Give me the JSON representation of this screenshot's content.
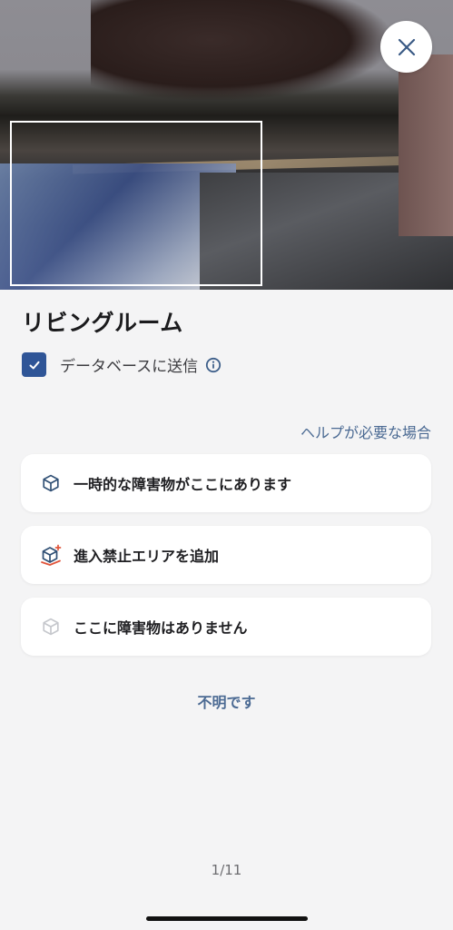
{
  "header": {
    "room_title": "リビングルーム",
    "close_icon": "close-icon"
  },
  "options": {
    "send_to_database_label": "データベースに送信",
    "send_to_database_checked": true,
    "info_icon": "info-icon"
  },
  "help_link": "ヘルプが必要な場合",
  "choices": [
    {
      "label": "一時的な障害物がここにあります",
      "icon": "box-icon",
      "color": "#2f4f74"
    },
    {
      "label": "進入禁止エリアを追加",
      "icon": "box-add-icon",
      "color": "#e0553b"
    },
    {
      "label": "ここに障害物はありません",
      "icon": "box-outline-icon",
      "color": "#c5c7cc"
    }
  ],
  "unknown_button": "不明です",
  "pager": "1/11",
  "colors": {
    "accent": "#2f5597",
    "link": "#4b6a93",
    "background": "#f4f4f5"
  }
}
